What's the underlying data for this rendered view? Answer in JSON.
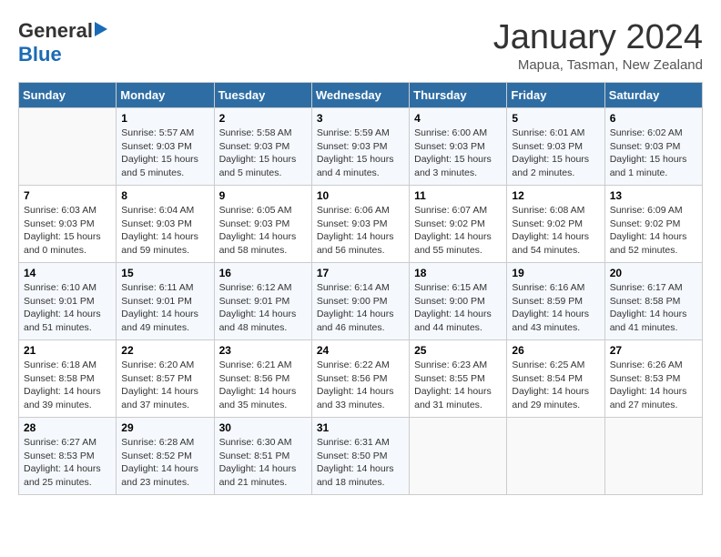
{
  "header": {
    "logo_general": "General",
    "logo_blue": "Blue",
    "title": "January 2024",
    "location": "Mapua, Tasman, New Zealand"
  },
  "days_of_week": [
    "Sunday",
    "Monday",
    "Tuesday",
    "Wednesday",
    "Thursday",
    "Friday",
    "Saturday"
  ],
  "weeks": [
    [
      {
        "day": "",
        "sunrise": "",
        "sunset": "",
        "daylight": ""
      },
      {
        "day": "1",
        "sunrise": "Sunrise: 5:57 AM",
        "sunset": "Sunset: 9:03 PM",
        "daylight": "Daylight: 15 hours and 5 minutes."
      },
      {
        "day": "2",
        "sunrise": "Sunrise: 5:58 AM",
        "sunset": "Sunset: 9:03 PM",
        "daylight": "Daylight: 15 hours and 5 minutes."
      },
      {
        "day": "3",
        "sunrise": "Sunrise: 5:59 AM",
        "sunset": "Sunset: 9:03 PM",
        "daylight": "Daylight: 15 hours and 4 minutes."
      },
      {
        "day": "4",
        "sunrise": "Sunrise: 6:00 AM",
        "sunset": "Sunset: 9:03 PM",
        "daylight": "Daylight: 15 hours and 3 minutes."
      },
      {
        "day": "5",
        "sunrise": "Sunrise: 6:01 AM",
        "sunset": "Sunset: 9:03 PM",
        "daylight": "Daylight: 15 hours and 2 minutes."
      },
      {
        "day": "6",
        "sunrise": "Sunrise: 6:02 AM",
        "sunset": "Sunset: 9:03 PM",
        "daylight": "Daylight: 15 hours and 1 minute."
      }
    ],
    [
      {
        "day": "7",
        "sunrise": "Sunrise: 6:03 AM",
        "sunset": "Sunset: 9:03 PM",
        "daylight": "Daylight: 15 hours and 0 minutes."
      },
      {
        "day": "8",
        "sunrise": "Sunrise: 6:04 AM",
        "sunset": "Sunset: 9:03 PM",
        "daylight": "Daylight: 14 hours and 59 minutes."
      },
      {
        "day": "9",
        "sunrise": "Sunrise: 6:05 AM",
        "sunset": "Sunset: 9:03 PM",
        "daylight": "Daylight: 14 hours and 58 minutes."
      },
      {
        "day": "10",
        "sunrise": "Sunrise: 6:06 AM",
        "sunset": "Sunset: 9:03 PM",
        "daylight": "Daylight: 14 hours and 56 minutes."
      },
      {
        "day": "11",
        "sunrise": "Sunrise: 6:07 AM",
        "sunset": "Sunset: 9:02 PM",
        "daylight": "Daylight: 14 hours and 55 minutes."
      },
      {
        "day": "12",
        "sunrise": "Sunrise: 6:08 AM",
        "sunset": "Sunset: 9:02 PM",
        "daylight": "Daylight: 14 hours and 54 minutes."
      },
      {
        "day": "13",
        "sunrise": "Sunrise: 6:09 AM",
        "sunset": "Sunset: 9:02 PM",
        "daylight": "Daylight: 14 hours and 52 minutes."
      }
    ],
    [
      {
        "day": "14",
        "sunrise": "Sunrise: 6:10 AM",
        "sunset": "Sunset: 9:01 PM",
        "daylight": "Daylight: 14 hours and 51 minutes."
      },
      {
        "day": "15",
        "sunrise": "Sunrise: 6:11 AM",
        "sunset": "Sunset: 9:01 PM",
        "daylight": "Daylight: 14 hours and 49 minutes."
      },
      {
        "day": "16",
        "sunrise": "Sunrise: 6:12 AM",
        "sunset": "Sunset: 9:01 PM",
        "daylight": "Daylight: 14 hours and 48 minutes."
      },
      {
        "day": "17",
        "sunrise": "Sunrise: 6:14 AM",
        "sunset": "Sunset: 9:00 PM",
        "daylight": "Daylight: 14 hours and 46 minutes."
      },
      {
        "day": "18",
        "sunrise": "Sunrise: 6:15 AM",
        "sunset": "Sunset: 9:00 PM",
        "daylight": "Daylight: 14 hours and 44 minutes."
      },
      {
        "day": "19",
        "sunrise": "Sunrise: 6:16 AM",
        "sunset": "Sunset: 8:59 PM",
        "daylight": "Daylight: 14 hours and 43 minutes."
      },
      {
        "day": "20",
        "sunrise": "Sunrise: 6:17 AM",
        "sunset": "Sunset: 8:58 PM",
        "daylight": "Daylight: 14 hours and 41 minutes."
      }
    ],
    [
      {
        "day": "21",
        "sunrise": "Sunrise: 6:18 AM",
        "sunset": "Sunset: 8:58 PM",
        "daylight": "Daylight: 14 hours and 39 minutes."
      },
      {
        "day": "22",
        "sunrise": "Sunrise: 6:20 AM",
        "sunset": "Sunset: 8:57 PM",
        "daylight": "Daylight: 14 hours and 37 minutes."
      },
      {
        "day": "23",
        "sunrise": "Sunrise: 6:21 AM",
        "sunset": "Sunset: 8:56 PM",
        "daylight": "Daylight: 14 hours and 35 minutes."
      },
      {
        "day": "24",
        "sunrise": "Sunrise: 6:22 AM",
        "sunset": "Sunset: 8:56 PM",
        "daylight": "Daylight: 14 hours and 33 minutes."
      },
      {
        "day": "25",
        "sunrise": "Sunrise: 6:23 AM",
        "sunset": "Sunset: 8:55 PM",
        "daylight": "Daylight: 14 hours and 31 minutes."
      },
      {
        "day": "26",
        "sunrise": "Sunrise: 6:25 AM",
        "sunset": "Sunset: 8:54 PM",
        "daylight": "Daylight: 14 hours and 29 minutes."
      },
      {
        "day": "27",
        "sunrise": "Sunrise: 6:26 AM",
        "sunset": "Sunset: 8:53 PM",
        "daylight": "Daylight: 14 hours and 27 minutes."
      }
    ],
    [
      {
        "day": "28",
        "sunrise": "Sunrise: 6:27 AM",
        "sunset": "Sunset: 8:53 PM",
        "daylight": "Daylight: 14 hours and 25 minutes."
      },
      {
        "day": "29",
        "sunrise": "Sunrise: 6:28 AM",
        "sunset": "Sunset: 8:52 PM",
        "daylight": "Daylight: 14 hours and 23 minutes."
      },
      {
        "day": "30",
        "sunrise": "Sunrise: 6:30 AM",
        "sunset": "Sunset: 8:51 PM",
        "daylight": "Daylight: 14 hours and 21 minutes."
      },
      {
        "day": "31",
        "sunrise": "Sunrise: 6:31 AM",
        "sunset": "Sunset: 8:50 PM",
        "daylight": "Daylight: 14 hours and 18 minutes."
      },
      {
        "day": "",
        "sunrise": "",
        "sunset": "",
        "daylight": ""
      },
      {
        "day": "",
        "sunrise": "",
        "sunset": "",
        "daylight": ""
      },
      {
        "day": "",
        "sunrise": "",
        "sunset": "",
        "daylight": ""
      }
    ]
  ]
}
